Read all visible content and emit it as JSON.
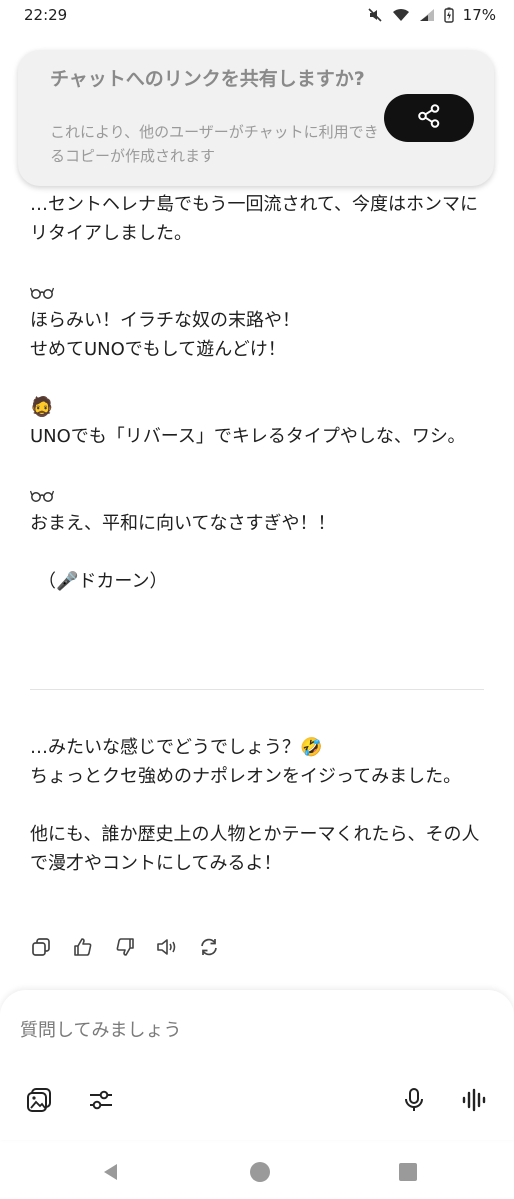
{
  "status_bar": {
    "time": "22:29",
    "battery": "17%",
    "icons": [
      "mute-icon",
      "wifi-icon",
      "signal-icon",
      "battery-charging-icon"
    ]
  },
  "share_banner": {
    "title": "チャットへのリンクを共有しますか?",
    "description": "これにより、他のユーザーがチャットに利用できるコピーが作成されます",
    "button_icon": "share-icon"
  },
  "conversation": {
    "line1": "…セントヘレナ島でもう一回流されて、今度はホンマにリタイアしました。",
    "speaker2_icon": "glasses-emoji",
    "line2": "ほらみい！イラチな奴の末路や！",
    "line3": "せめてUNOでもして遊んどけ！",
    "speaker1_emoji": "🧔",
    "line4": "UNOでも「リバース」でキレるタイプやしな、ワシ。",
    "line5": "おまえ、平和に向いてなさすぎや！！",
    "line6_prefix": "（",
    "line6_emoji": "🎤",
    "line6_suffix": "ドカーン）"
  },
  "reply": {
    "line1": "…みたいな感じでどうでしょう？🤣",
    "line2": "ちょっとクセ強めのナポレオンをイジってみました。",
    "line3": "他にも、誰か歴史上の人物とかテーマくれたら、その人で漫才やコントにしてみるよ！"
  },
  "response_actions": [
    "copy-icon",
    "thumbs-up-icon",
    "thumbs-down-icon",
    "read-aloud-icon",
    "regenerate-icon"
  ],
  "input": {
    "placeholder": "質問してみましょう"
  },
  "colors": {
    "background": "#ffffff",
    "text": "#1f1f1f",
    "banner_bg": "#f1f1f1",
    "banner_button": "#111111"
  }
}
